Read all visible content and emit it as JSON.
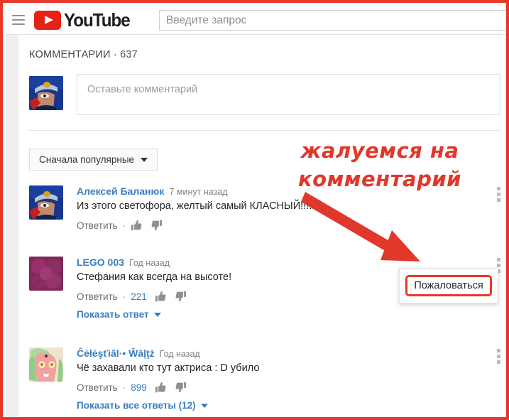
{
  "window": {
    "frame_color": "#e8372a"
  },
  "masthead": {
    "menu_icon": "hamburger-icon",
    "logo_text": "YouTube",
    "search_placeholder": "Введите запрос",
    "search_value": ""
  },
  "comments": {
    "header_label": "КОММЕНТАРИИ",
    "separator": "·",
    "count": "637",
    "composer_placeholder": "Оставьте комментарий",
    "sort_label": "Сначала популярные",
    "items": [
      {
        "author": "Алексей Баланюк",
        "time": "7 минут назад",
        "text": "Из этого светофора, желтый самый КЛАСНЫЙ!!!!!!!",
        "reply_label": "Ответить",
        "likes": "",
        "show_replies": ""
      },
      {
        "author": "LEGO 003",
        "time": "Год назад",
        "text": "Стефания как всегда на высоте!",
        "reply_label": "Ответить",
        "likes": "221",
        "show_replies": "Показать ответ"
      },
      {
        "author": "Ĉėłéşťiăl·• Ŵāļţż",
        "time": "Год назад",
        "text": "Чё захавали кто тут актриса : D убило",
        "reply_label": "Ответить",
        "likes": "899",
        "show_replies": "Показать все ответы (12)"
      }
    ]
  },
  "report_popup": {
    "item_label": "Пожаловаться"
  },
  "annotation": {
    "line1": "жалуемся на",
    "line2": "комментарий",
    "color": "#e0382b"
  }
}
